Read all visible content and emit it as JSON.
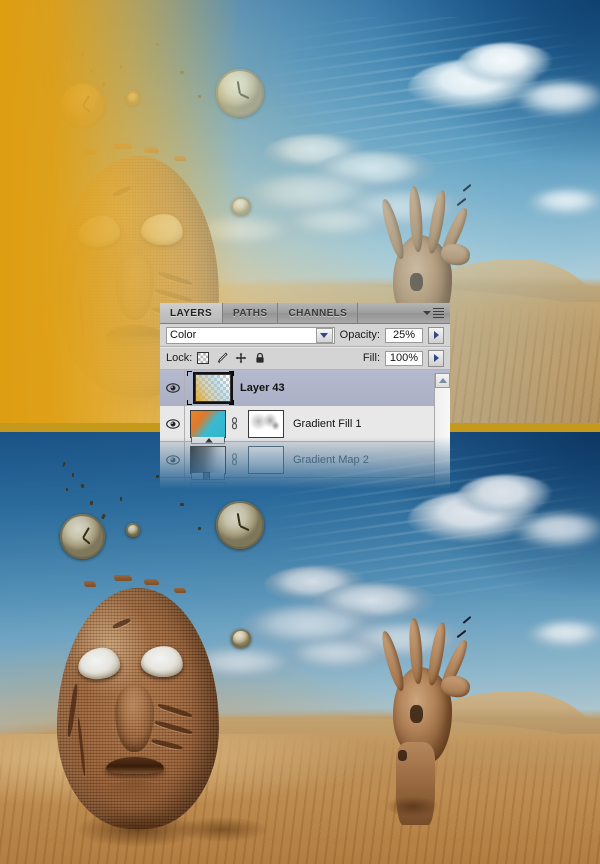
{
  "artwork": {
    "top": {
      "name": "before-preview-with-color-layer",
      "description": "Desert scene with burlap face and hand, washed with a yellow-to-cyan Color blend layer at 25% opacity"
    },
    "bottom": {
      "name": "after-preview-final",
      "description": "Desert scene with burlap face and hand, final color grading with blue sky and orange sand"
    }
  },
  "panel": {
    "tabs": [
      {
        "label": "LAYERS",
        "active": true
      },
      {
        "label": "PATHS",
        "active": false
      },
      {
        "label": "CHANNELS",
        "active": false
      }
    ],
    "menu_icon": "panel-menu-icon",
    "blend_mode": {
      "label": "blend-mode",
      "value": "Color",
      "dropdown_icon": "chevron-down-icon"
    },
    "opacity": {
      "label": "Opacity:",
      "value": "25%",
      "stepper_icon": "arrow-right-icon"
    },
    "lock": {
      "label": "Lock:",
      "icons": [
        "lock-transparent-pixels-icon",
        "lock-image-pixels-icon",
        "lock-position-icon",
        "lock-all-icon"
      ]
    },
    "fill": {
      "label": "Fill:",
      "value": "100%",
      "stepper_icon": "arrow-right-icon"
    },
    "scrollbar": {
      "up_icon": "scroll-up-icon"
    },
    "layers": [
      {
        "name": "Layer 43",
        "visible": true,
        "selected": true,
        "eye_icon": "eye-icon",
        "thumbnail": "gradient-checker-thumbnail",
        "has_mask": false,
        "mask_thumbnail": null,
        "link_icon": null
      },
      {
        "name": "Gradient Fill 1",
        "visible": true,
        "selected": false,
        "eye_icon": "eye-icon",
        "thumbnail": "orange-cyan-gradient-thumbnail",
        "has_mask": true,
        "mask_thumbnail": "white-mask-thumbnail",
        "link_icon": "link-mask-icon"
      },
      {
        "name": "Gradient Map 2",
        "visible": true,
        "selected": false,
        "eye_icon": "eye-icon",
        "thumbnail": "black-white-gradient-thumbnail",
        "has_mask": true,
        "mask_thumbnail": "white-mask-thumbnail",
        "link_icon": "link-mask-icon"
      }
    ]
  },
  "colors": {
    "panel_bg": "#d4d4d4",
    "tab_active": "#c6c6c6",
    "selection": "#b0b5c9",
    "gradient_fill_start": "#e07b22",
    "gradient_fill_end": "#2fb6cf",
    "sky_blue": "#1f5f96",
    "sand_orange": "#c08c4c",
    "wash_yellow": "#dea912"
  }
}
